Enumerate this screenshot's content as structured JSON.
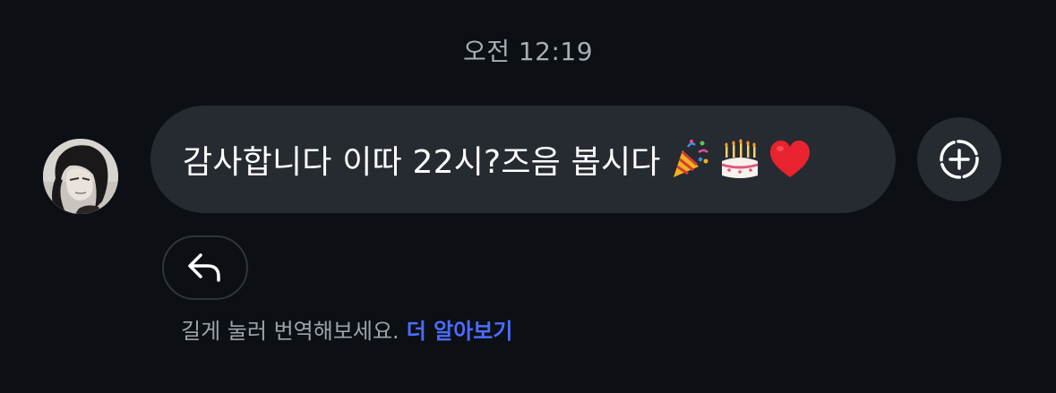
{
  "timestamp": "오전 12:19",
  "message": {
    "sender": {
      "avatar_icon": "profile-photo"
    },
    "text": "감사합니다 이따 22시?즈음 봅시다",
    "emojis": [
      "party-popper",
      "birthday-cake",
      "red-heart"
    ]
  },
  "actions": {
    "add_reaction_icon": "add-reaction-icon",
    "reply_icon": "reply-arrow-icon"
  },
  "translate_hint": {
    "text": "길게 눌러 번역해보세요.",
    "link_label": "더 알아보기",
    "link_color": "#4c6cff"
  },
  "colors": {
    "background": "#0c0f14",
    "bubble": "#262a31",
    "muted_text": "#a9adb4"
  }
}
